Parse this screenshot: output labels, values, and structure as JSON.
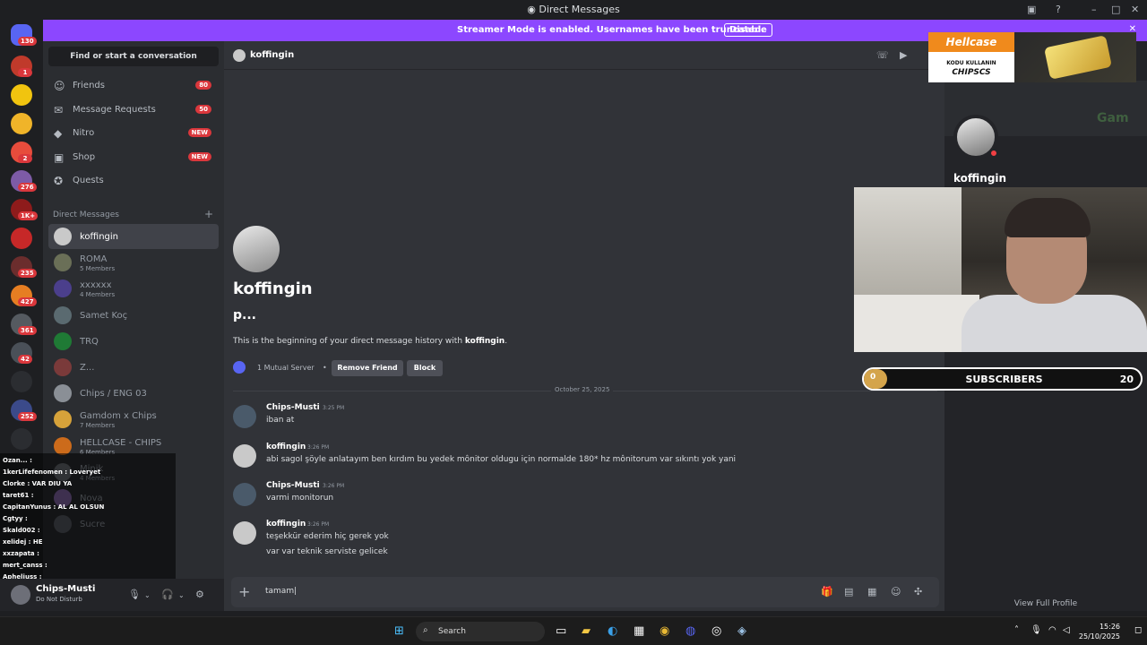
{
  "window": {
    "title": "Direct Messages"
  },
  "banner": {
    "message": "Streamer Mode is enabled. Usernames have been truncated.",
    "disable_label": "Disable"
  },
  "rail": {
    "home_badge": "130",
    "servers": [
      {
        "badge": "1",
        "color": "#c03a2b"
      },
      {
        "badge": "",
        "color": "#f1c40f"
      },
      {
        "badge": "",
        "color": "#f0b429"
      },
      {
        "badge": "2",
        "color": "#e74c3c"
      },
      {
        "badge": "276",
        "color": "#7d5ba6"
      },
      {
        "badge": "1K+",
        "color": "#8e1b1b"
      },
      {
        "badge": "",
        "color": "#c62828"
      },
      {
        "badge": "235",
        "color": "#6b2d2d"
      },
      {
        "badge": "427",
        "color": "#e67e22"
      },
      {
        "badge": "361",
        "color": "#555a60"
      },
      {
        "badge": "42",
        "color": "#4a5058"
      },
      {
        "badge": "",
        "color": "#2b2d31"
      },
      {
        "badge": "252",
        "color": "#3b4a8a"
      }
    ]
  },
  "sidebar": {
    "find_placeholder": "Find or start a conversation",
    "nav": [
      {
        "label": "Friends",
        "icon": "friends-icon",
        "count": "80"
      },
      {
        "label": "Message Requests",
        "icon": "mail-icon",
        "count": "50"
      },
      {
        "label": "Nitro",
        "icon": "nitro-icon",
        "new": "NEW"
      },
      {
        "label": "Shop",
        "icon": "shop-icon",
        "new": "NEW"
      },
      {
        "label": "Quests",
        "icon": "quests-icon"
      }
    ],
    "dm_header": "Direct Messages",
    "dms": [
      {
        "name": "koffingin",
        "sub": "",
        "color": "#c9c9c9"
      },
      {
        "name": "ROMA",
        "sub": "5 Members",
        "color": "#6a6f57"
      },
      {
        "name": "xxxxxx",
        "sub": "4 Members",
        "color": "#4b3f8c"
      },
      {
        "name": "Samet Koç",
        "sub": "",
        "color": "#5a6a70"
      },
      {
        "name": "TRQ",
        "sub": "",
        "color": "#1f7a35"
      },
      {
        "name": "Z...",
        "sub": "",
        "color": "#7a3a3a"
      },
      {
        "name": "Chips / ENG 03",
        "sub": "",
        "color": "#8a8f96"
      },
      {
        "name": "Gamdom x Chips",
        "sub": "7 Members",
        "color": "#d6a23a"
      },
      {
        "name": "HELLCASE - CHIPS",
        "sub": "6 Members",
        "color": "#cc6b1b"
      },
      {
        "name": "Minik",
        "sub": "4 Members",
        "color": "#6b6f76"
      },
      {
        "name": "Nova",
        "sub": "",
        "color": "#8a6bb0"
      },
      {
        "name": "Sucre",
        "sub": "",
        "color": "#5a5e66"
      }
    ]
  },
  "stream_chat": [
    "Ozan... : ",
    "1kerLifefenomen : Loveryet",
    "Clorke : VAR DIU YA",
    "taret61 : ",
    "CapitanYunus : AL AL OLSUN",
    "Cgtyy : ",
    "Skald002 : ",
    "xelidej : HE",
    "xxzapata : ",
    "mert_canss : ",
    "Apheliuss : "
  ],
  "user": {
    "name": "Chips-Musti",
    "status": "Do Not Disturb"
  },
  "channel": {
    "name": "koffingin"
  },
  "intro": {
    "name": "koffingin",
    "subtitle": "p...",
    "text_prefix": "This is the beginning of your direct message history with ",
    "text_name": "koffingin",
    "text_suffix": ".",
    "mutual": "1 Mutual Server",
    "remove_friend": "Remove Friend",
    "block": "Block"
  },
  "date_divider": "October 25, 2025",
  "messages": [
    {
      "author": "Chips-Musti",
      "time": "3:25 PM",
      "lines": [
        "iban at"
      ],
      "color": "#4a5a6a"
    },
    {
      "author": "koffingin",
      "time": "3:26 PM",
      "lines": [
        "abi sagol şöyle anlatayım ben kırdım bu yedek mônitor oldugu için normalde 180* hz mônitorum var sıkıntı yok yani"
      ],
      "color": "#c9c9c9"
    },
    {
      "author": "Chips-Musti",
      "time": "3:26 PM",
      "lines": [
        "varmi monitorun"
      ],
      "color": "#4a5a6a"
    },
    {
      "author": "koffingin",
      "time": "3:26 PM",
      "lines": [
        "teşekkür ederim hiç gerek yok",
        "var var teknik serviste gelicek"
      ],
      "color": "#c9c9c9"
    }
  ],
  "composer": {
    "value": "tamam"
  },
  "profile": {
    "name": "koffingin",
    "view_full": "View Full Profile",
    "bg_text": "Gam"
  },
  "promo": {
    "logo": "Hellcase",
    "line1": "KODU KULLANIN",
    "line2": "CHIPSCS"
  },
  "subs": {
    "label": "SUBSCRIBERS",
    "current": "0",
    "goal": "20",
    "progress": 0
  },
  "taskbar": {
    "search": "Search",
    "time": "15:26",
    "date": "25/10/2025"
  }
}
